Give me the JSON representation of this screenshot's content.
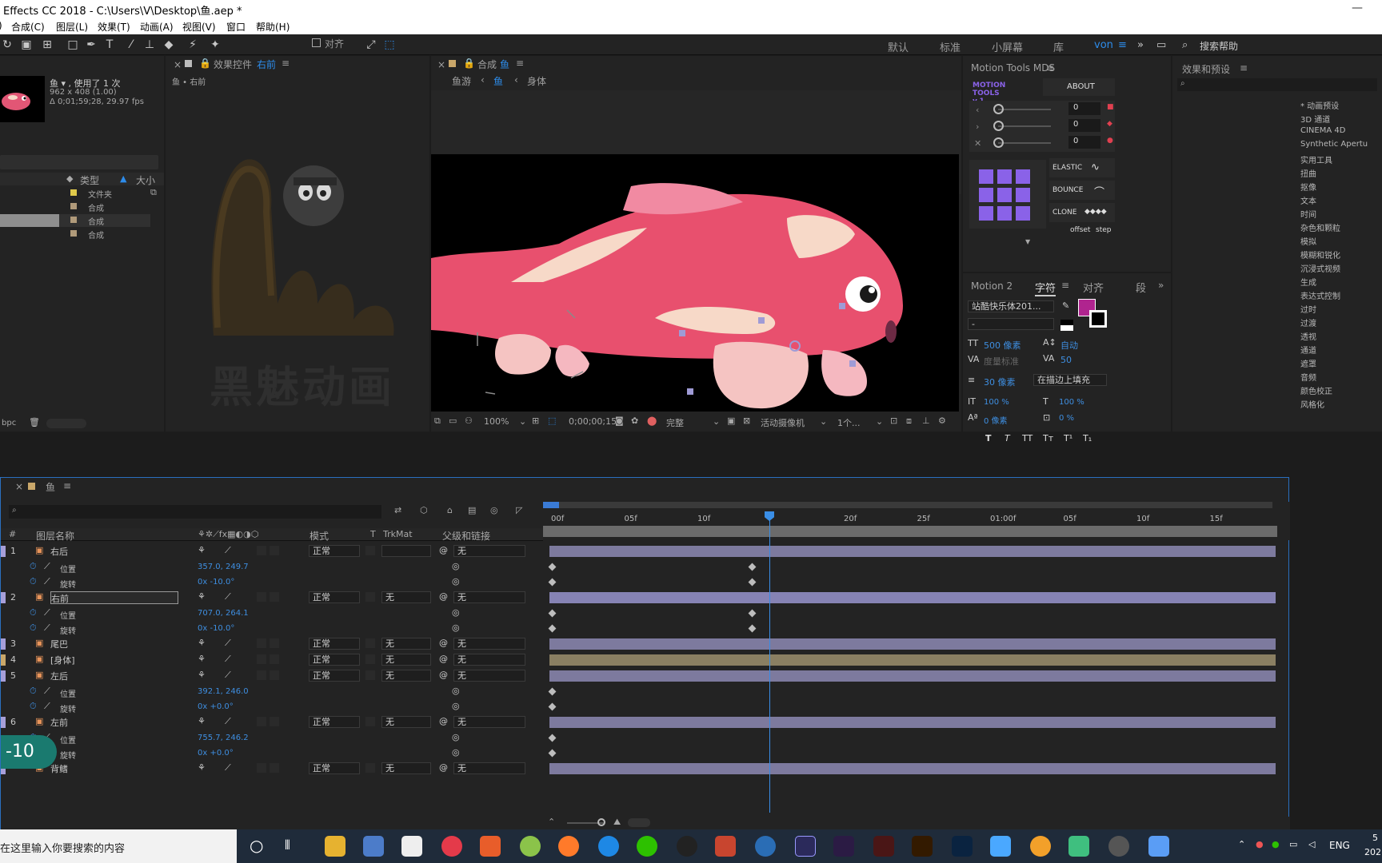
{
  "titlebar": {
    "title": "Effects CC 2018 - C:\\Users\\V\\Desktop\\鱼.aep *",
    "min": "—"
  },
  "menu": [
    "合成(C)",
    "图层(L)",
    "效果(T)",
    "动画(A)",
    "视图(V)",
    "窗口",
    "帮助(H)"
  ],
  "toolbar": {
    "snap_label": "对齐"
  },
  "workspaces": [
    "默认",
    "标准",
    "小屏幕",
    "库",
    "von"
  ],
  "search_help": "搜索帮助",
  "project": {
    "name": "鱼 ▾ , 使用了 1 次",
    "size": "962 x 408 (1.00)",
    "duration": "Δ 0;01;59;28, 29.97 fps",
    "col_type": "类型",
    "col_size": "大小",
    "items": [
      "文件夹",
      "合成",
      "合成",
      "合成"
    ],
    "bpc": "bpc"
  },
  "effects_panel": {
    "tab": "效果控件",
    "layer": "右前",
    "breadcrumb": "鱼 • 右前",
    "watermark": "黑魅动画"
  },
  "comp_panel": {
    "tab": "合成",
    "comp": "鱼",
    "crumbs": [
      "鱼游",
      "鱼",
      "身体"
    ],
    "zoom": "100%",
    "timecode": "0;00;00;15",
    "quality": "完整",
    "camera": "活动摄像机",
    "views": "1个..."
  },
  "motion_tools": {
    "tab": "Motion Tools MDS",
    "logo": "MOTION TOOLS v.1",
    "about": "ABOUT",
    "sliders": [
      "0",
      "0",
      "0"
    ],
    "elastic": "ELASTIC",
    "bounce": "BOUNCE",
    "clone": "CLONE",
    "offset": "offset",
    "step": "step"
  },
  "char_panel": {
    "tabs": [
      "Motion 2",
      "字符",
      "对齐",
      "段"
    ],
    "font": "站酷快乐体201...",
    "style": "-",
    "size": "500 像素",
    "leading": "自动",
    "kern": "度量标准",
    "track": "50",
    "stroke": "30 像素",
    "stroke_mode": "在描边上填充",
    "vscale": "100 %",
    "hscale": "100 %",
    "baseline": "0 像素",
    "tsume": "0 %",
    "fill_color": "#b0248f",
    "buttons": [
      "T",
      "T",
      "TT",
      "Tт",
      "T¹",
      "T₁"
    ]
  },
  "effects_presets": {
    "tab": "效果和预设",
    "items": [
      "* 动画预设",
      "3D 通道",
      "CINEMA 4D",
      "Synthetic Apertu",
      "实用工具",
      "扭曲",
      "抠像",
      "文本",
      "时间",
      "杂色和颗粒",
      "模拟",
      "模糊和锐化",
      "沉浸式视频",
      "生成",
      "表达式控制",
      "过时",
      "过渡",
      "透视",
      "通道",
      "遮罩",
      "音频",
      "颜色校正",
      "风格化"
    ]
  },
  "timeline": {
    "tab": "鱼",
    "headers": {
      "num": "#",
      "name": "图层名称",
      "mode": "模式",
      "t": "T",
      "trkmat": "TrkMat",
      "parent": "父级和链接"
    },
    "ruler": [
      "00f",
      "05f",
      "10f",
      "",
      "20f",
      "25f",
      "01:00f",
      "05f",
      "10f",
      "15f"
    ],
    "layers": [
      {
        "n": "1",
        "name": "右后",
        "mode": "正常",
        "trk": "",
        "parent": "无",
        "props": [
          {
            "label": "位置",
            "value": "357.0, 249.7"
          },
          {
            "label": "旋转",
            "value": "0x -10.0°"
          }
        ]
      },
      {
        "n": "2",
        "name": "右前",
        "mode": "正常",
        "trk": "无",
        "parent": "无",
        "props": [
          {
            "label": "位置",
            "value": "707.0, 264.1"
          },
          {
            "label": "旋转",
            "value": "0x -10.0°"
          }
        ]
      },
      {
        "n": "3",
        "name": "尾巴",
        "mode": "正常",
        "trk": "无",
        "parent": "无",
        "props": []
      },
      {
        "n": "4",
        "name": "[身体]",
        "mode": "正常",
        "trk": "无",
        "parent": "无",
        "props": []
      },
      {
        "n": "5",
        "name": "左后",
        "mode": "正常",
        "trk": "无",
        "parent": "无",
        "props": [
          {
            "label": "位置",
            "value": "392.1, 246.0"
          },
          {
            "label": "旋转",
            "value": "0x +0.0°"
          }
        ]
      },
      {
        "n": "6",
        "name": "左前",
        "mode": "正常",
        "trk": "无",
        "parent": "无",
        "props": [
          {
            "label": "位置",
            "value": "755.7, 246.2"
          },
          {
            "label": "旋转",
            "value": "0x +0.0°"
          }
        ]
      },
      {
        "n": "",
        "name": "背鳍",
        "mode": "正常",
        "trk": "无",
        "parent": "无",
        "props": []
      }
    ],
    "overlay": "-10"
  },
  "taskbar": {
    "search": "在这里输入你要搜索的内容",
    "lang": "ENG",
    "clock": "5",
    "date": "202"
  }
}
